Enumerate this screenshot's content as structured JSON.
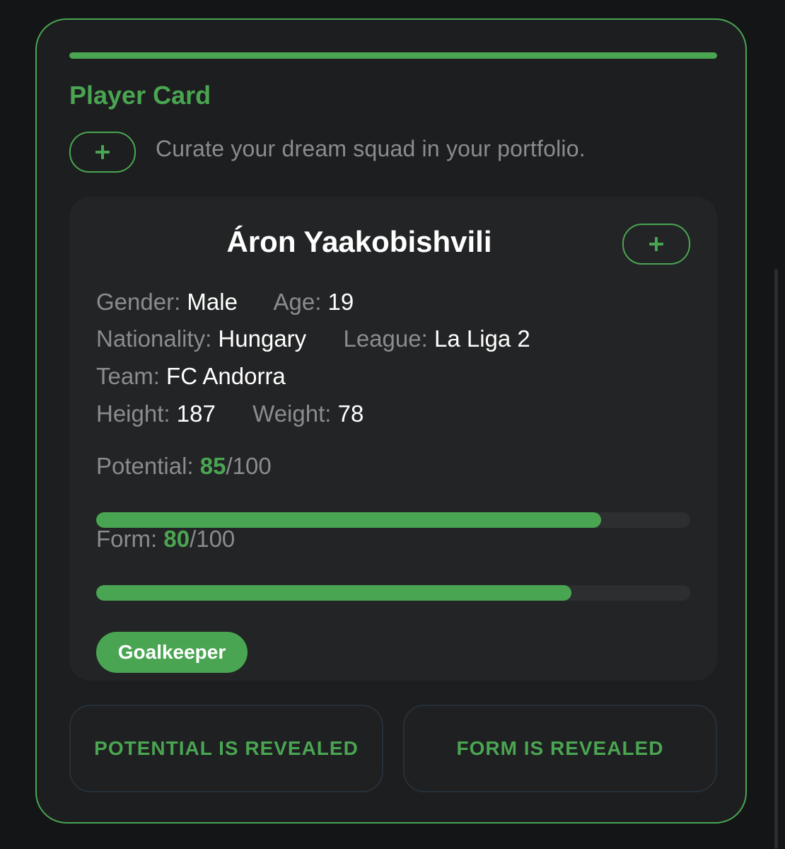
{
  "card": {
    "title": "Player Card",
    "add_icon": "plus-icon",
    "tagline": "Curate your dream squad in your portfolio."
  },
  "player": {
    "name": "Áron Yaakobishvili",
    "add_icon": "plus-icon",
    "fields": {
      "gender": {
        "label": "Gender:",
        "value": "Male"
      },
      "age": {
        "label": "Age:",
        "value": "19"
      },
      "nationality": {
        "label": "Nationality:",
        "value": "Hungary"
      },
      "league": {
        "label": "League:",
        "value": "La Liga 2"
      },
      "team": {
        "label": "Team:",
        "value": "FC Andorra"
      },
      "height": {
        "label": "Height:",
        "value": "187"
      },
      "weight": {
        "label": "Weight:",
        "value": "78"
      }
    },
    "stats": {
      "potential": {
        "label": "Potential:",
        "value": 85,
        "max_text": "/100",
        "max": 100
      },
      "form": {
        "label": "Form:",
        "value": 80,
        "max_text": "/100",
        "max": 100
      }
    },
    "position": "Goalkeeper"
  },
  "actions": {
    "potential_revealed": "POTENTIAL IS REVEALED",
    "form_revealed": "FORM IS REVEALED"
  },
  "colors": {
    "accent": "#4aa552",
    "background": "#141516",
    "card": "#1d1e1f",
    "inner_card": "#232425",
    "muted_text": "#8b8c8e"
  }
}
